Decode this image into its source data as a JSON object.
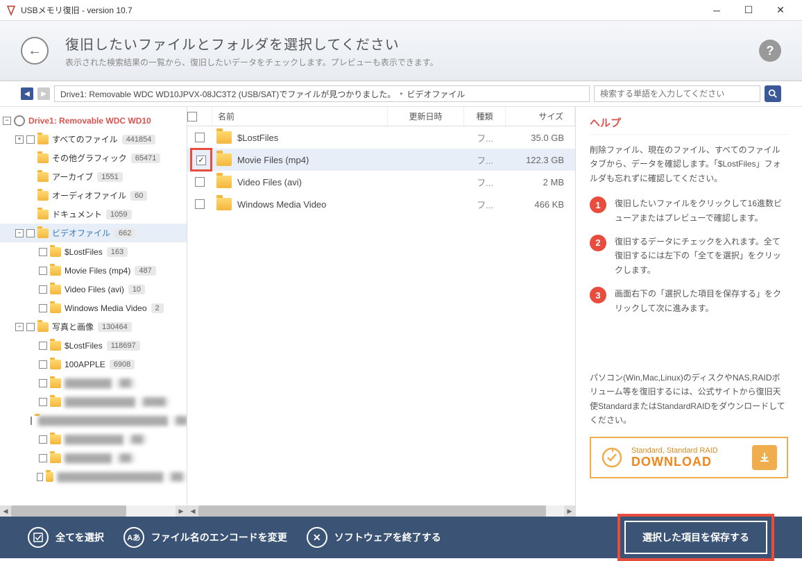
{
  "titlebar": {
    "title": "USBメモリ復旧 - version 10.7"
  },
  "header": {
    "title": "復旧したいファイルとフォルダを選択してください",
    "subtitle": "表示された検索結果の一覧から、復旧したいデータをチェックします。プレビューも表示できます。"
  },
  "crumb": {
    "path": "Drive1: Removable WDC WD10JPVX-08JC3T2 (USB/SAT)でファイルが見つかりました。",
    "current": "ビデオファイル",
    "search_placeholder": "検索する単語を入力してください"
  },
  "tree": {
    "root": "Drive1: Removable WDC WD10",
    "items": [
      {
        "label": "すべてのファイル",
        "count": "441854",
        "depth": 1,
        "expander": "plus",
        "chk": true
      },
      {
        "label": "その他グラフィック",
        "count": "65471",
        "depth": 1,
        "expander": "none"
      },
      {
        "label": "アーカイブ",
        "count": "1551",
        "depth": 1,
        "expander": "none"
      },
      {
        "label": "オーディオファイル",
        "count": "60",
        "depth": 1,
        "expander": "none"
      },
      {
        "label": "ドキュメント",
        "count": "1059",
        "depth": 1,
        "expander": "none"
      },
      {
        "label": "ビデオファイル",
        "count": "662",
        "depth": 1,
        "expander": "minus",
        "highlight": true,
        "selected": true,
        "chk": true
      },
      {
        "label": "$LostFiles",
        "count": "163",
        "depth": 2,
        "expander": "none",
        "chk": true
      },
      {
        "label": "Movie Files (mp4)",
        "count": "487",
        "depth": 2,
        "expander": "none",
        "chk": true
      },
      {
        "label": "Video Files (avi)",
        "count": "10",
        "depth": 2,
        "expander": "none",
        "chk": true
      },
      {
        "label": "Windows Media Video",
        "count": "2",
        "depth": 2,
        "expander": "none",
        "chk": true
      },
      {
        "label": "写真と画像",
        "count": "130464",
        "depth": 1,
        "expander": "minus",
        "chk": true
      },
      {
        "label": "$LostFiles",
        "count": "118697",
        "depth": 2,
        "expander": "none",
        "chk": true
      },
      {
        "label": "100APPLE",
        "count": "6908",
        "depth": 2,
        "expander": "none",
        "chk": true
      },
      {
        "label": "████████",
        "count": "██",
        "depth": 2,
        "expander": "none",
        "blur": true,
        "chk": true
      },
      {
        "label": "████████████",
        "count": "████",
        "depth": 2,
        "expander": "none",
        "blur": true,
        "chk": true
      },
      {
        "label": "██████████████████████",
        "count": "██",
        "depth": 2,
        "expander": "none",
        "blur": true,
        "chk": true
      },
      {
        "label": "██████████",
        "count": "██",
        "depth": 2,
        "expander": "none",
        "blur": true,
        "chk": true
      },
      {
        "label": "████████",
        "count": "██",
        "depth": 2,
        "expander": "none",
        "blur": true,
        "chk": true
      },
      {
        "label": "██████████████████",
        "count": "██",
        "depth": 2,
        "expander": "none",
        "blur": true,
        "chk": true
      }
    ]
  },
  "file_list": {
    "headers": {
      "name": "名前",
      "date": "更新日時",
      "type": "種類",
      "size": "サイズ"
    },
    "rows": [
      {
        "name": "$LostFiles",
        "type": "フ...",
        "size": "35.0 GB",
        "checked": false
      },
      {
        "name": "Movie Files (mp4)",
        "type": "フ...",
        "size": "122.3 GB",
        "checked": true,
        "selected": true,
        "highlight": true
      },
      {
        "name": "Video Files (avi)",
        "type": "フ...",
        "size": "2 MB",
        "checked": false
      },
      {
        "name": "Windows Media Video",
        "type": "フ...",
        "size": "466 KB",
        "checked": false
      }
    ]
  },
  "help": {
    "title": "ヘルプ",
    "intro": "削除ファイル、現在のファイル、すべてのファイルタブから、データを確認します。「$LostFiles」フォルダも忘れずに確認してください。",
    "steps": [
      "復旧したいファイルをクリックして16進数ビューアまたはプレビューで確認します。",
      "復旧するデータにチェックを入れます。全て復旧するには左下の「全てを選択」をクリックします。",
      "画面右下の「選択した項目を保存する」をクリックして次に進みます。"
    ],
    "promo": "パソコン(Win,Mac,Linux)のディスクやNAS,RAIDボリューム等を復旧するには、公式サイトから復旧天使StandardまたはStandardRAIDをダウンロードしてください。",
    "download": {
      "line1": "Standard, Standard RAID",
      "line2": "DOWNLOAD"
    }
  },
  "footer": {
    "select_all": "全てを選択",
    "encoding": "ファイル名のエンコードを変更",
    "exit": "ソフトウェアを終了する",
    "save": "選択した項目を保存する"
  }
}
